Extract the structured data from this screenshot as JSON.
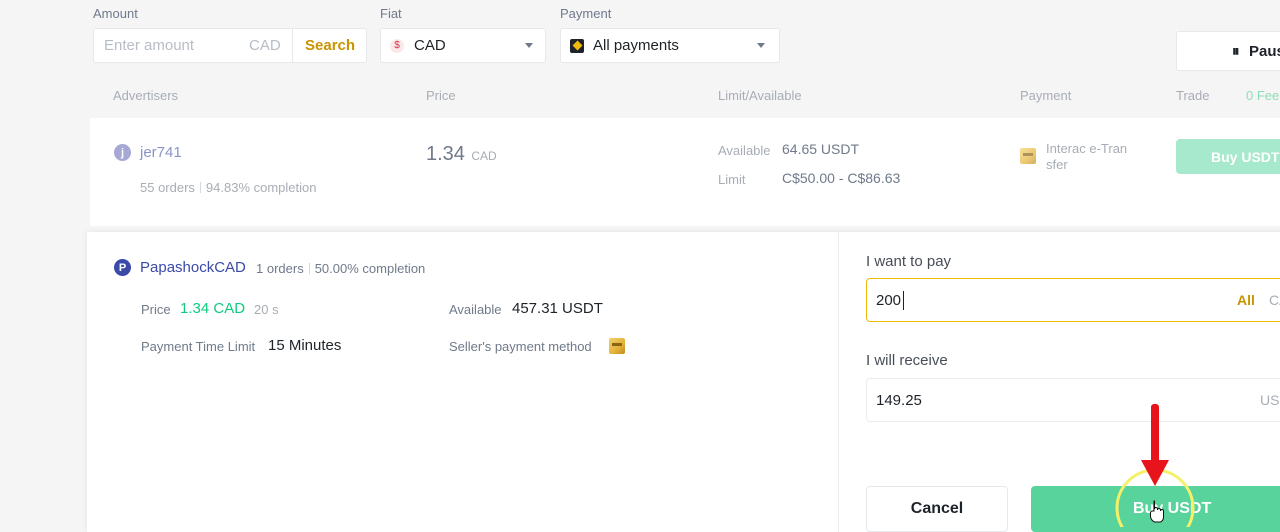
{
  "filters": {
    "amount": {
      "label": "Amount",
      "placeholder": "Enter amount",
      "unit": "CAD",
      "search_label": "Search"
    },
    "fiat": {
      "label": "Fiat",
      "currency_symbol": "$",
      "selected": "CAD"
    },
    "payment": {
      "label": "Payment",
      "selected": "All payments"
    },
    "pause_label": "Paus"
  },
  "table": {
    "headers": {
      "advertisers": "Advertisers",
      "price": "Price",
      "limit": "Limit/Available",
      "payment": "Payment",
      "trade": "Trade",
      "fee": "0 Fee"
    }
  },
  "ad1": {
    "avatar_letter": "j",
    "name": "jer741",
    "orders": "55 orders",
    "completion": "94.83% completion",
    "price": "1.34",
    "price_unit": "CAD",
    "available_label": "Available",
    "available": "64.65 USDT",
    "limit_label": "Limit",
    "limit": "C$50.00 - C$86.63",
    "payment_line1": "Interac e-Tran",
    "payment_line2": "sfer",
    "buy_label": "Buy USDT"
  },
  "ad2": {
    "avatar_letter": "P",
    "name": "PapashockCAD",
    "orders": "1 orders",
    "completion": "50.00% completion",
    "price_label": "Price",
    "price": "1.34 CAD",
    "timer": "20 s",
    "available_label": "Available",
    "available": "457.31 USDT",
    "time_limit_label": "Payment Time Limit",
    "time_limit": "15 Minutes",
    "seller_method_label": "Seller's payment method"
  },
  "order_form": {
    "pay_label": "I want to pay",
    "pay_value": "200",
    "all_label": "All",
    "pay_unit": "CA",
    "receive_label": "I will receive",
    "receive_value": "149.25",
    "receive_unit": "US",
    "cancel_label": "Cancel",
    "buy_label": "Buy USDT"
  },
  "colors": {
    "brand_yellow": "#F0B90B",
    "green": "#0ECB81",
    "annotation_red": "#E8141C"
  }
}
